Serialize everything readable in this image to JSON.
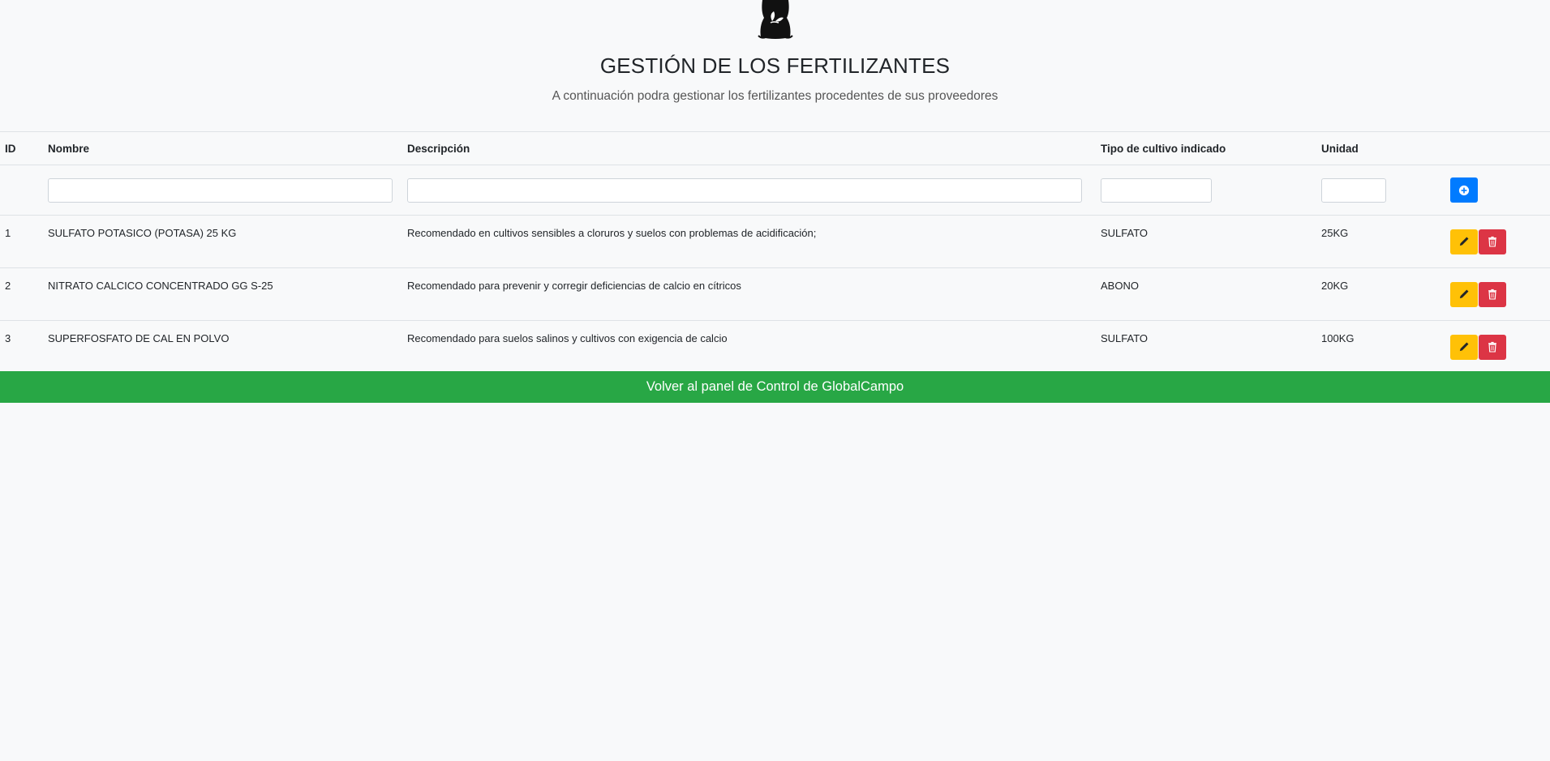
{
  "header": {
    "logo_icon": "fertilizer-bag-icon",
    "title": "GESTIÓN DE LOS FERTILIZANTES",
    "subtitle": "A continuación podra gestionar los fertilizantes procedentes de sus proveedores"
  },
  "table": {
    "columns": [
      "ID",
      "Nombre",
      "Descripción",
      "Tipo de cultivo indicado",
      "Unidad",
      ""
    ],
    "filters": {
      "nombre": "",
      "descripcion": "",
      "tipo": "",
      "unidad": ""
    },
    "add_icon": "plus-circle-icon",
    "edit_icon": "pencil-icon",
    "delete_icon": "trash-icon",
    "rows": [
      {
        "id": "1",
        "nombre": "SULFATO POTASICO (POTASA) 25 KG",
        "descripcion": "Recomendado en cultivos sensibles a cloruros y suelos con problemas de acidificación;",
        "tipo": "SULFATO",
        "unidad": "25KG"
      },
      {
        "id": "2",
        "nombre": "NITRATO CALCICO CONCENTRADO GG S-25",
        "descripcion": "Recomendado para prevenir y corregir deficiencias de calcio en cítricos",
        "tipo": "ABONO",
        "unidad": "20KG"
      },
      {
        "id": "3",
        "nombre": "SUPERFOSFATO DE CAL EN POLVO",
        "descripcion": "Recomendado para suelos salinos y cultivos con exigencia de calcio",
        "tipo": "SULFATO",
        "unidad": "100KG"
      }
    ]
  },
  "footer": {
    "back_label": "Volver al panel de Control de GlobalCampo"
  },
  "colors": {
    "background": "#f8f9fa",
    "primary": "#007bff",
    "warning": "#ffc107",
    "danger": "#dc3545",
    "success": "#28a745"
  }
}
